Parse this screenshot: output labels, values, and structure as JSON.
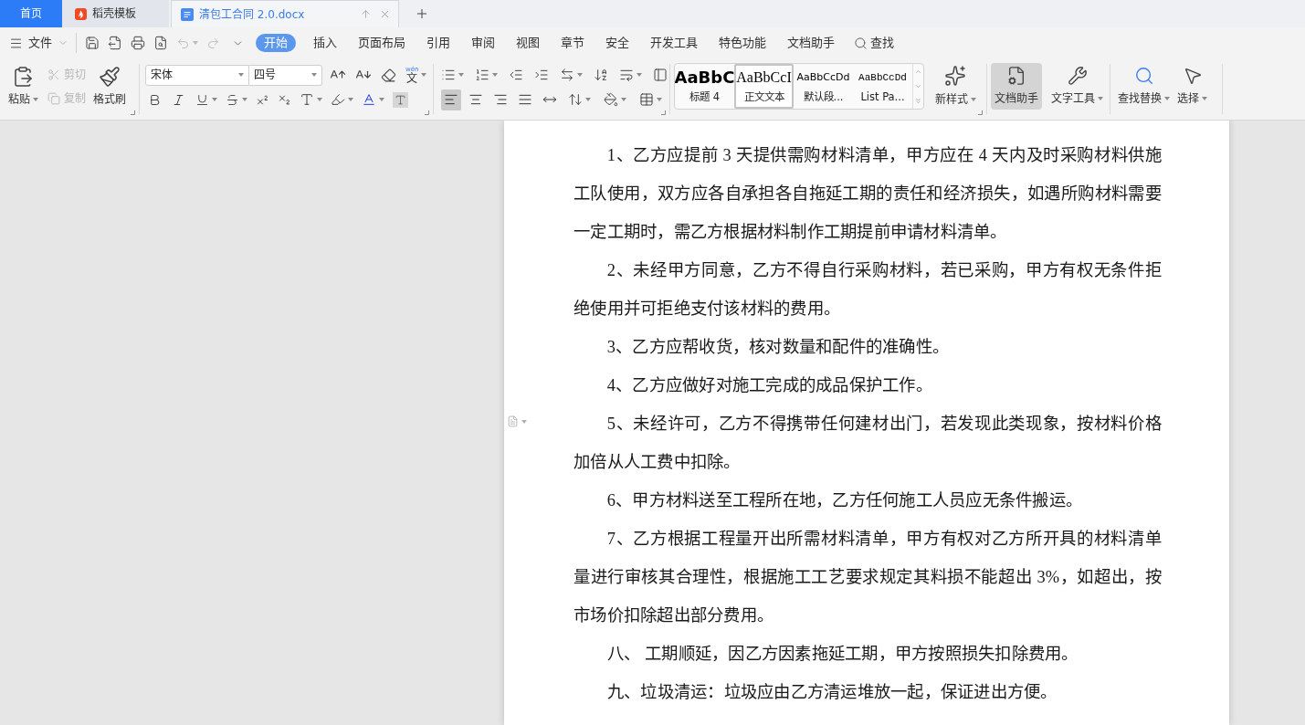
{
  "tabs": [
    {
      "label": "首页",
      "kind": "home",
      "selected": false
    },
    {
      "label": "稻壳模板",
      "kind": "template",
      "selected": false
    },
    {
      "label": "清包工合同 2.0.docx",
      "kind": "document",
      "selected": true
    }
  ],
  "menu_bar": {
    "file_label": "文件",
    "ribbon_tabs": [
      {
        "label": "开始",
        "selected": true
      },
      {
        "label": "插入",
        "selected": false
      },
      {
        "label": "页面布局",
        "selected": false
      },
      {
        "label": "引用",
        "selected": false
      },
      {
        "label": "审阅",
        "selected": false
      },
      {
        "label": "视图",
        "selected": false
      },
      {
        "label": "章节",
        "selected": false
      },
      {
        "label": "安全",
        "selected": false
      },
      {
        "label": "开发工具",
        "selected": false
      },
      {
        "label": "特色功能",
        "selected": false
      },
      {
        "label": "文档助手",
        "selected": false
      }
    ],
    "search_label": "查找"
  },
  "ribbon": {
    "paste": "粘贴",
    "cut": {
      "label": "剪切",
      "disabled": true
    },
    "copy": {
      "label": "复制",
      "disabled": true
    },
    "format_painter": "格式刷",
    "font_family": "宋体",
    "font_size": "四号",
    "phonetic_guide": {
      "ruby": "wén",
      "character": "文"
    },
    "alignment": [
      {
        "kind": "left",
        "selected": true
      },
      {
        "kind": "center",
        "selected": false
      },
      {
        "kind": "right",
        "selected": false
      },
      {
        "kind": "justify",
        "selected": false
      },
      {
        "kind": "distributed",
        "selected": false
      }
    ],
    "styles": [
      {
        "preview": "AaBbC",
        "label": "标题 4",
        "kind": "heading",
        "selected": false
      },
      {
        "preview": "AaBbCcI",
        "label": "正文文本",
        "kind": "body",
        "selected": true
      },
      {
        "preview": "AaBbCcDd",
        "label": "默认段...",
        "kind": "default",
        "selected": false
      },
      {
        "preview": "AaBbCcDd",
        "label": "List Pa...",
        "kind": "list",
        "selected": false
      }
    ],
    "new_style": "新样式",
    "tools": [
      {
        "label": "文档助手",
        "kind": "assistant",
        "selected": true
      },
      {
        "label": "文字工具",
        "kind": "text-tools",
        "selected": false
      }
    ],
    "find_replace": "查找替换",
    "select": "选择"
  },
  "document": {
    "paragraphs": [
      {
        "text": "1、乙方应提前 3 天提供需购材料清单，甲方应在 4 天内及时采购材料供施工队使用，双方应各自承担各自拖延工期的责任和经济损失，如遇所购材料需要一定工期时，需乙方根据材料制作工期提前申请材料清单。",
        "gutter_marker": false
      },
      {
        "text": "2、未经甲方同意，乙方不得自行采购材料，若已采购，甲方有权无条件拒绝使用并可拒绝支付该材料的费用。",
        "gutter_marker": false
      },
      {
        "text": "3、乙方应帮收货，核对数量和配件的准确性。",
        "gutter_marker": false
      },
      {
        "text": "4、乙方应做好对施工完成的成品保护工作。",
        "gutter_marker": false
      },
      {
        "text": "5、未经许可，乙方不得携带任何建材出门，若发现此类现象，按材料价格加倍从人工费中扣除。",
        "gutter_marker": true
      },
      {
        "text": "6、甲方材料送至工程所在地，乙方任何施工人员应无条件搬运。",
        "gutter_marker": false
      },
      {
        "text": "7、乙方根据工程量开出所需材料清单，甲方有权对乙方所开具的材料清单量进行审核其合理性，根据施工工艺要求规定其料损不能超出 3%，如超出，按市场价扣除超出部分费用。",
        "gutter_marker": false
      },
      {
        "text": "八、 工期顺延，因乙方因素拖延工期，甲方按照损失扣除费用。",
        "gutter_marker": false
      },
      {
        "text": "九、垃圾清运：垃圾应由乙方清运堆放一起，保证进出方便。",
        "gutter_marker": false
      }
    ]
  }
}
